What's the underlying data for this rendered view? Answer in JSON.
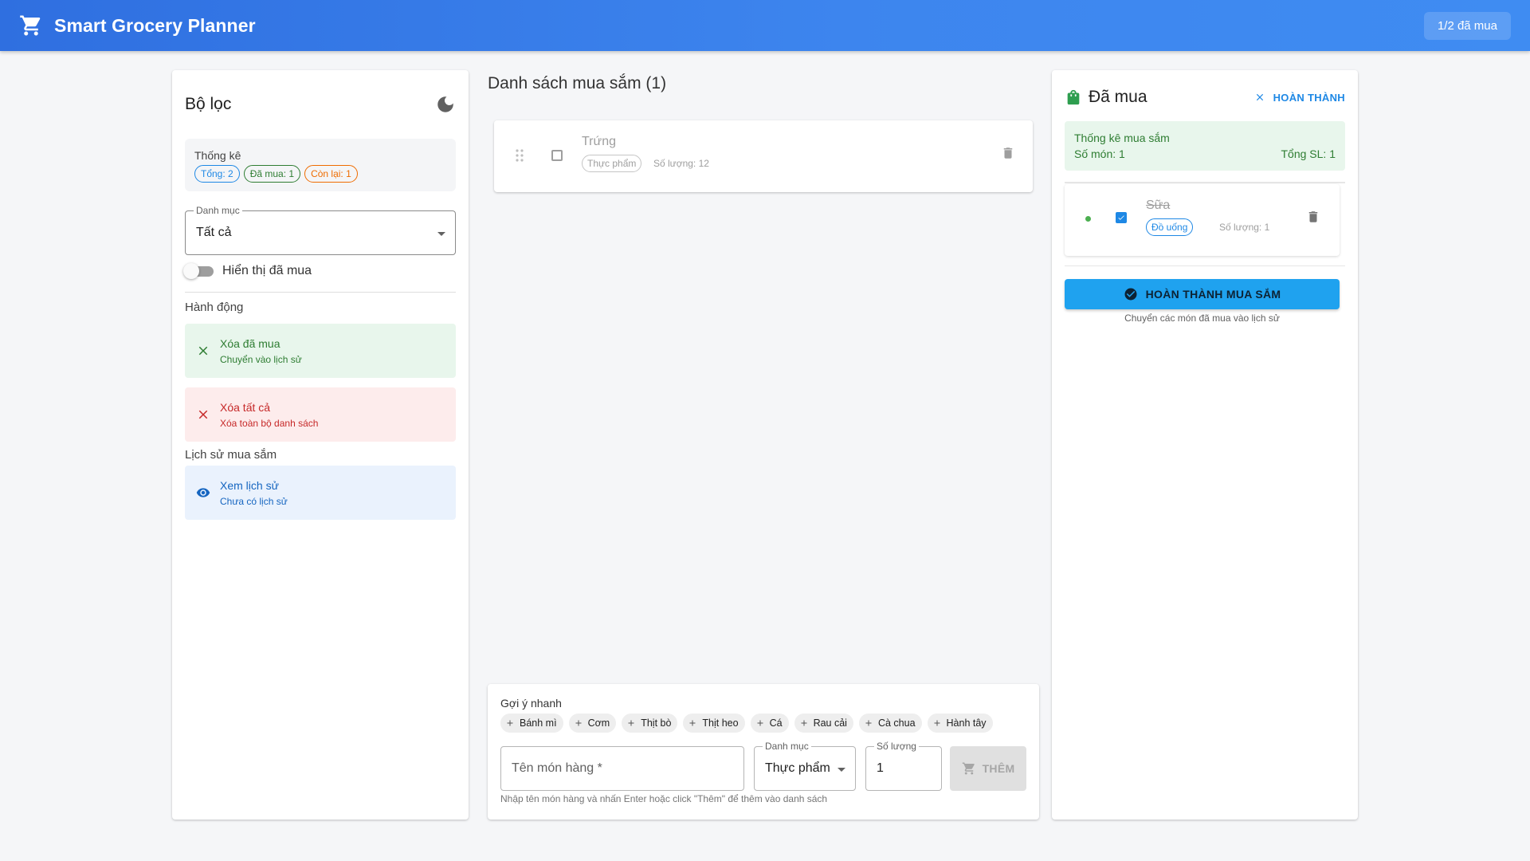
{
  "appbar": {
    "title": "Smart Grocery Planner",
    "badge": "1/2 đã mua"
  },
  "filters": {
    "title": "Bộ lọc",
    "stats_label": "Thống kê",
    "chip_total": "Tổng: 2",
    "chip_bought": "Đã mua: 1",
    "chip_remaining": "Còn lại: 1",
    "category_label": "Danh mục",
    "category_value": "Tất cả",
    "show_bought_label": "Hiển thị đã mua",
    "actions_title": "Hành động",
    "clear_bought_title": "Xóa đã mua",
    "clear_bought_sub": "Chuyển vào lịch sử",
    "clear_all_title": "Xóa tất cả",
    "clear_all_sub": "Xóa toàn bộ danh sách",
    "history_title": "Lịch sử mua sắm",
    "view_history_title": "Xem lịch sử",
    "view_history_sub": "Chưa có lịch sử"
  },
  "list": {
    "title": "Danh sách mua sắm (1)",
    "items": [
      {
        "name": "Trứng",
        "category": "Thực phẩm",
        "quantity": "Số lượng: 12"
      }
    ]
  },
  "add": {
    "suggest_title": "Gợi ý nhanh",
    "suggestions": [
      "Bánh mì",
      "Cơm",
      "Thịt bò",
      "Thịt heo",
      "Cá",
      "Rau cải",
      "Cà chua",
      "Hành tây"
    ],
    "name_placeholder": "Tên món hàng *",
    "category_label": "Danh mục",
    "category_value": "Thực phẩm",
    "qty_label": "Số lượng",
    "qty_value": "1",
    "add_button": "THÊM",
    "hint": "Nhập tên món hàng và nhấn Enter hoặc click \"Thêm\" để thêm vào danh sách"
  },
  "bought": {
    "title": "Đã mua",
    "done_link": "HOÀN THÀNH",
    "stats_title": "Thống kê mua sắm",
    "stats_count": "Số món: 1",
    "stats_total": "Tổng SL: 1",
    "items": [
      {
        "name": "Sữa",
        "category": "Đồ uống",
        "quantity": "Số lượng: 1"
      }
    ],
    "finish_button": "HOÀN THÀNH MUA SẮM",
    "finish_hint": "Chuyển các món đã mua vào lịch sử"
  },
  "colors": {
    "primary": "#2f6fe0",
    "success": "#2e7d32",
    "danger": "#c62828",
    "info": "#1e88e5"
  },
  "icons": [
    "cart-icon",
    "moon-icon",
    "close-icon",
    "eye-icon",
    "drag-icon",
    "trash-icon",
    "plus-icon",
    "bag-icon",
    "check-circle-icon"
  ]
}
